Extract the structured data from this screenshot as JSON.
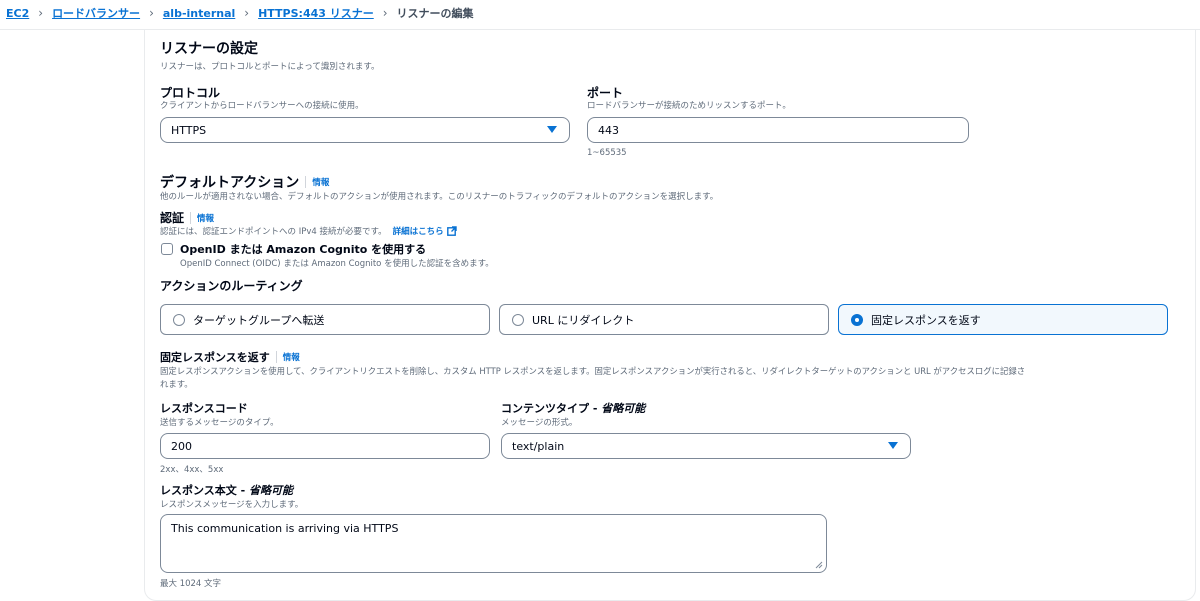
{
  "breadcrumb": {
    "items": [
      "EC2",
      "ロードバランサー",
      "alb-internal",
      "HTTPS:443 リスナー"
    ],
    "current": "リスナーの編集"
  },
  "listener": {
    "title": "リスナーの設定",
    "description": "リスナーは、プロトコルとポートによって識別されます。",
    "protocol": {
      "label": "プロトコル",
      "description": "クライアントからロードバランサーへの接続に使用。",
      "value": "HTTPS"
    },
    "port": {
      "label": "ポート",
      "description": "ロードバランサーが接続のためリッスンするポート。",
      "value": "443",
      "hint": "1~65535"
    }
  },
  "default_action": {
    "title": "デフォルトアクション",
    "info": "情報",
    "description": "他のルールが適用されない場合、デフォルトのアクションが使用されます。このリスナーのトラフィックのデフォルトのアクションを選択します。"
  },
  "auth": {
    "title": "認証",
    "info": "情報",
    "description": "認証には、認証エンドポイントへの IPv4 接続が必要です。",
    "details_link": "詳細はこちら",
    "checkbox_label": "OpenID または Amazon Cognito を使用する",
    "checkbox_description": "OpenID Connect (OIDC) または Amazon Cognito を使用した認証を含めます。",
    "checked": false
  },
  "routing": {
    "title": "アクションのルーティング",
    "options": [
      "ターゲットグループへ転送",
      "URL にリダイレクト",
      "固定レスポンスを返す"
    ],
    "selected_index": 2
  },
  "fixed_response": {
    "title": "固定レスポンスを返す",
    "info": "情報",
    "description_line1": "固定レスポンスアクションを使用して、クライアントリクエストを削除し、カスタム HTTP レスポンスを返します。固定レスポンスアクションが実行されると、リダイレクトターゲットのアクションと URL がアクセスログに記録さ",
    "description_line2": "れます。",
    "response_code": {
      "label": "レスポンスコード",
      "description": "送信するメッセージのタイプ。",
      "value": "200",
      "hint": "2xx、4xx、5xx"
    },
    "content_type": {
      "label": "コンテンツタイプ - ",
      "optional": "省略可能",
      "description": "メッセージの形式。",
      "value": "text/plain"
    },
    "body": {
      "label": "レスポンス本文 - ",
      "optional": "省略可能",
      "description": "レスポンスメッセージを入力します。",
      "value": "This communication is arriving via HTTPS",
      "hint": "最大 1024 文字"
    }
  },
  "colors": {
    "link": "#0972d3",
    "border": "#7d8998",
    "selected_bg": "#f2f8fd",
    "text": "#000716",
    "muted": "#5f6b7a"
  }
}
